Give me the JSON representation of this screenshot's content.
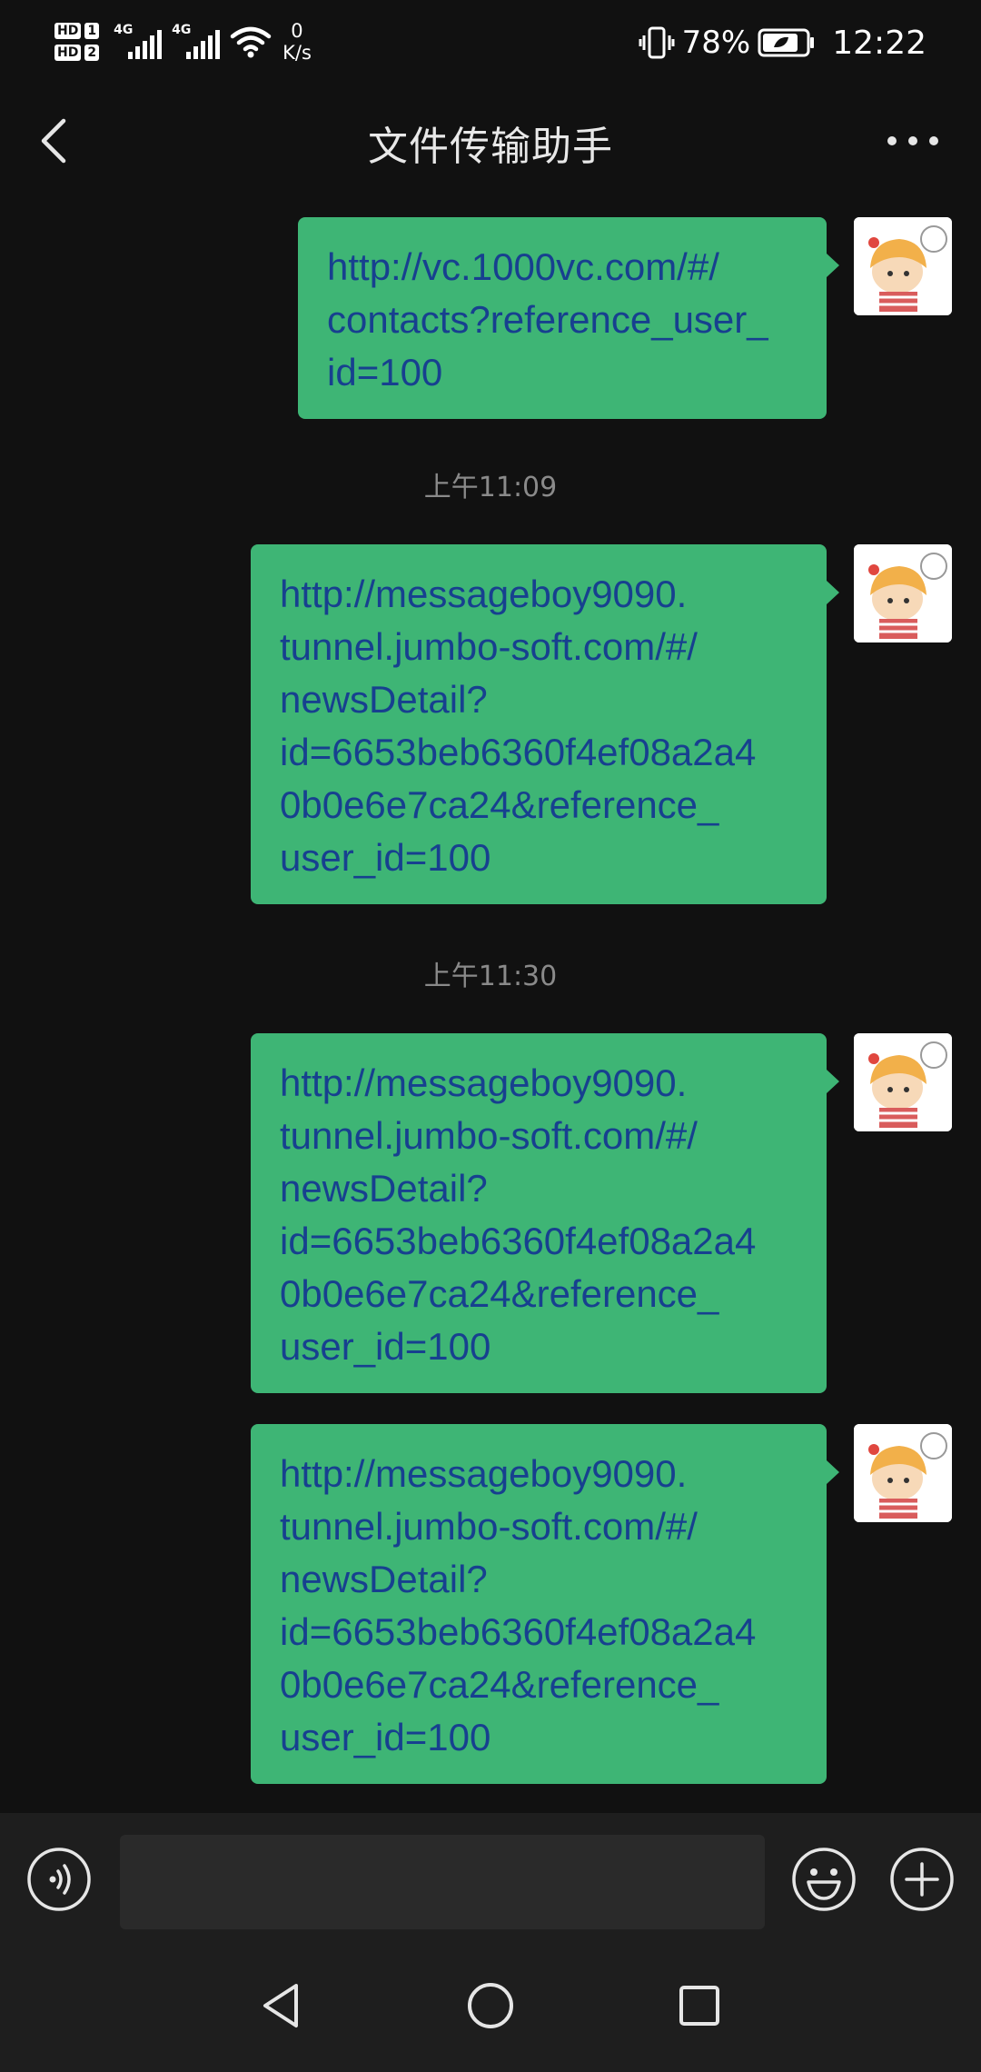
{
  "status_bar": {
    "sim1": "HD",
    "sim1_slot": "1",
    "sim2": "HD",
    "sim2_slot": "2",
    "network1": "4G",
    "network2": "4G",
    "speed_value": "0",
    "speed_unit": "K/s",
    "battery_percent": "78%",
    "time": "12:22"
  },
  "header": {
    "title": "文件传输助手"
  },
  "messages": [
    {
      "text": "http://vc.1000vc.com/#/\ncontacts?reference_user_\nid=100"
    },
    {
      "text": "http://messageboy9090.\ntunnel.jumbo-soft.com/#/\nnewsDetail?\nid=6653beb6360f4ef08a2a4\n0b0e6e7ca24&reference_\nuser_id=100"
    },
    {
      "text": "http://messageboy9090.\ntunnel.jumbo-soft.com/#/\nnewsDetail?\nid=6653beb6360f4ef08a2a4\n0b0e6e7ca24&reference_\nuser_id=100"
    },
    {
      "text": "http://messageboy9090.\ntunnel.jumbo-soft.com/#/\nnewsDetail?\nid=6653beb6360f4ef08a2a4\n0b0e6e7ca24&reference_\nuser_id=100"
    }
  ],
  "timestamps": [
    "上午11:09",
    "上午11:30"
  ],
  "input_bar": {
    "placeholder": "",
    "icons": [
      "voice-icon",
      "emoji-icon",
      "plus-icon"
    ]
  },
  "nav_bar": {
    "icons": [
      "back-triangle-icon",
      "home-circle-icon",
      "recent-square-icon"
    ]
  },
  "colors": {
    "background": "#111111",
    "bubble": "#3eb575",
    "link_text": "#17408f",
    "timestamp": "#8a8a8a"
  }
}
